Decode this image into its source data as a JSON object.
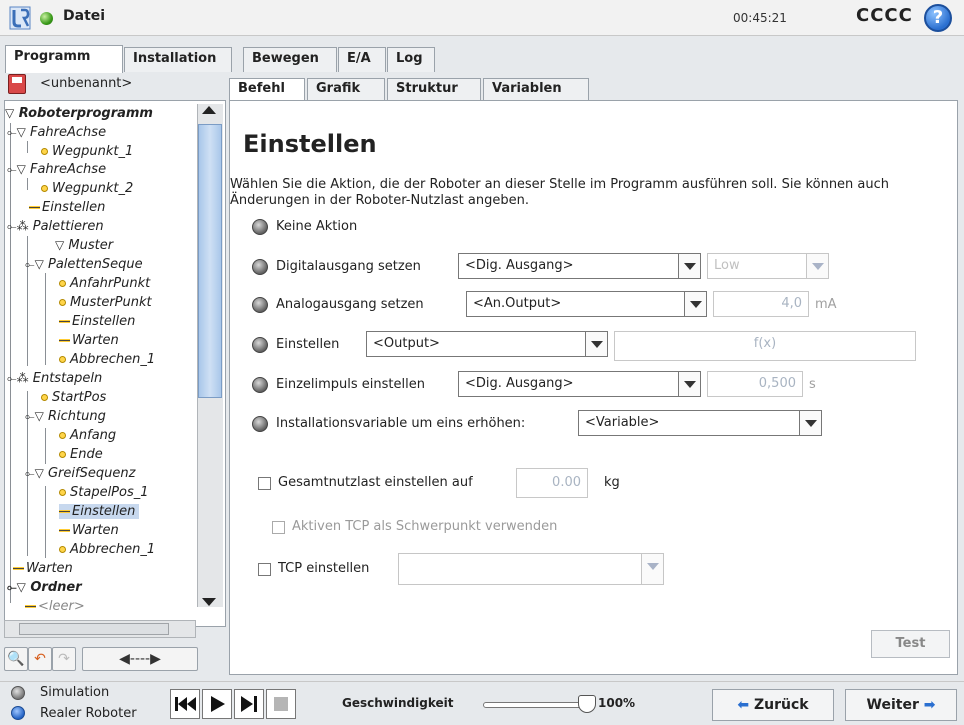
{
  "topbar": {
    "file_menu": "Datei",
    "clock": "00:45:21",
    "robot_name": "CCCC",
    "help": "?"
  },
  "main_tabs": [
    "Programm",
    "Installation",
    "Bewegen",
    "E/A",
    "Log"
  ],
  "file": {
    "name": "<unbenannt>"
  },
  "sub_tabs": [
    "Befehl",
    "Grafik",
    "Struktur",
    "Variablen"
  ],
  "tree": [
    "Roboterprogramm",
    "FahreAchse",
    "Wegpunkt_1",
    "FahreAchse",
    "Wegpunkt_2",
    "Einstellen",
    "Palettieren",
    "Muster",
    "PalettenSeque",
    "AnfahrPunkt",
    "MusterPunkt",
    "Einstellen",
    "Warten",
    "Abbrechen_1",
    "Entstapeln",
    "StartPos",
    "Richtung",
    "Anfang",
    "Ende",
    "GreifSequenz",
    "StapelPos_1",
    "Einstellen",
    "Warten",
    "Abbrechen_1",
    "Warten",
    "Ordner",
    "<leer>"
  ],
  "content": {
    "title": "Einstellen",
    "description": "Wählen Sie die Aktion, die der Roboter an dieser Stelle im Programm ausführen soll. Sie können auch Änderungen in der Roboter-Nutzlast angeben.",
    "opt_none": "Keine Aktion",
    "opt_digital": "Digitalausgang setzen",
    "digital_select": "<Dig. Ausgang>",
    "digital_level": "Low",
    "opt_analog": "Analogausgang setzen",
    "analog_select": "<An.Output>",
    "analog_value": "4,0",
    "analog_unit": "mA",
    "opt_set": "Einstellen",
    "set_select": "<Output>",
    "set_expression": "f(x)",
    "opt_pulse": "Einzelimpuls einstellen",
    "pulse_select": "<Dig. Ausgang>",
    "pulse_value": "0,500",
    "pulse_unit": "s",
    "opt_increment": "Installationsvariable um eins erhöhen:",
    "increment_select": "<Variable>",
    "payload_label": "Gesamtnutzlast einstellen auf",
    "payload_value": "0.00",
    "payload_unit": "kg",
    "tcp_cog_label": "Aktiven TCP als Schwerpunkt verwenden",
    "tcp_label": "TCP einstellen",
    "test_button": "Test"
  },
  "bottom": {
    "mode_sim": "Simulation",
    "mode_real": "Realer Roboter",
    "speed_label": "Geschwindigkeit",
    "speed_value": "100%",
    "back": "Zurück",
    "next": "Weiter"
  }
}
